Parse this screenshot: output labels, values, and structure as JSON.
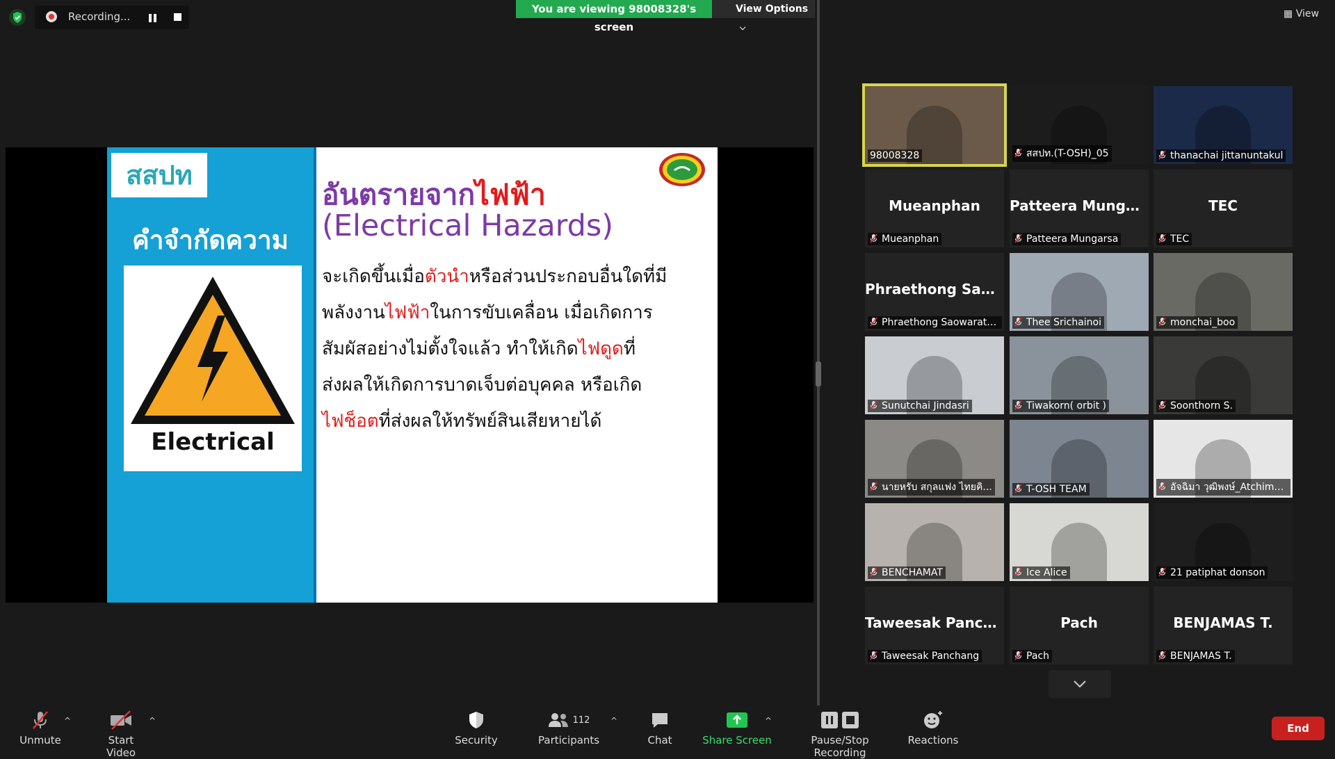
{
  "recording": {
    "label": "Recording..."
  },
  "banner": {
    "viewing": "You are viewing 98008328's screen",
    "view_options": "View Options"
  },
  "gallery_view_label": "View",
  "slide": {
    "logo_text": "สสปท",
    "definition_heading": "คำจำกัดความ",
    "sign_label": "Electrical",
    "title_prefix": "อันตรายจาก",
    "title_highlight": "ไฟฟ้า",
    "title_en": "(Electrical Hazards)",
    "body": {
      "l1a": "จะเกิดขึ้นเมื่อ",
      "l1r": "ตัวนำ",
      "l1b": "หรือส่วนประกอบอื่นใดที่มี",
      "l2a": "พลังงาน",
      "l2r": "ไฟฟ้า",
      "l2b": "ในการขับเคลื่อน เมื่อเกิดการ",
      "l3a": "สัมผัสอย่างไม่ตั้งใจแล้ว ทำให้เกิด",
      "l3r": "ไฟดูด",
      "l3b": "ที่",
      "l4": "ส่งผลให้เกิดการบาดเจ็บต่อบุคคล หรือเกิด",
      "l5r": "ไฟช็อต",
      "l5b": "ที่ส่งผลให้ทรัพย์สินเสียหายได้"
    }
  },
  "participants": [
    {
      "label": "98008328",
      "big": "",
      "muted": false,
      "active": true,
      "bg": "#6b5a4a"
    },
    {
      "label": "สสปท.(T-OSH)_05",
      "big": "",
      "muted": true,
      "active": false,
      "bg": "#1c1c1c"
    },
    {
      "label": "thanachai jittanuntakul",
      "big": "",
      "muted": true,
      "active": false,
      "bg": "#1b2a48"
    },
    {
      "label": "Mueanphan",
      "big": "Mueanphan",
      "muted": true,
      "active": false,
      "bg": "#232323"
    },
    {
      "label": "Patteera Mungarsa",
      "big": "Patteera  Munga...",
      "muted": true,
      "active": false,
      "bg": "#232323"
    },
    {
      "label": "TEC",
      "big": "TEC",
      "muted": true,
      "active": false,
      "bg": "#232323"
    },
    {
      "label": "Phraethong Saowarata...",
      "big": "Phraethong  Sao...",
      "muted": true,
      "active": false,
      "bg": "#232323"
    },
    {
      "label": "Thee Srichainoi",
      "big": "",
      "muted": true,
      "active": false,
      "bg": "#9fa9b4"
    },
    {
      "label": "monchai_boo",
      "big": "",
      "muted": true,
      "active": false,
      "bg": "#6a6a64"
    },
    {
      "label": "Sunutchai  Jindasri",
      "big": "",
      "muted": true,
      "active": false,
      "bg": "#c9cdd2"
    },
    {
      "label": "Tiwakorn( orbit )",
      "big": "",
      "muted": true,
      "active": false,
      "bg": "#8a939b"
    },
    {
      "label": "Soonthorn S.",
      "big": "",
      "muted": true,
      "active": false,
      "bg": "#3a3a38"
    },
    {
      "label": "นายหรับ  สกุลแฟง  ไทยคิ...",
      "big": "",
      "muted": true,
      "active": false,
      "bg": "#8c8a86"
    },
    {
      "label": "T-OSH TEAM",
      "big": "",
      "muted": true,
      "active": false,
      "bg": "#7d8590"
    },
    {
      "label": "อัจฉิมา วุฒิพงษ์_Atchima ...",
      "big": "",
      "muted": true,
      "active": false,
      "bg": "#e6e6e6"
    },
    {
      "label": "BENCHAMAT",
      "big": "",
      "muted": true,
      "active": false,
      "bg": "#b7b2ad"
    },
    {
      "label": "Ice Alice",
      "big": "",
      "muted": true,
      "active": false,
      "bg": "#d7d7d3"
    },
    {
      "label": "21 patiphat donson",
      "big": "",
      "muted": true,
      "active": false,
      "bg": "#1e1e1e"
    },
    {
      "label": "Taweesak Panchang",
      "big": "Taweesak  Panch...",
      "muted": true,
      "active": false,
      "bg": "#232323"
    },
    {
      "label": "Pach",
      "big": "Pach",
      "muted": true,
      "active": false,
      "bg": "#232323"
    },
    {
      "label": "BENJAMAS T.",
      "big": "BENJAMAS  T.",
      "muted": true,
      "active": false,
      "bg": "#232323"
    }
  ],
  "toolbar": {
    "unmute": "Unmute",
    "start_video": "Start Video",
    "security": "Security",
    "participants": "Participants",
    "participants_count": "112",
    "chat": "Chat",
    "share_screen": "Share Screen",
    "pause_stop_recording": "Pause/Stop Recording",
    "reactions": "Reactions",
    "end": "End"
  },
  "colors": {
    "share_green": "#23a94f",
    "end_red": "#c8201e",
    "active_speaker": "#d8d64a"
  }
}
